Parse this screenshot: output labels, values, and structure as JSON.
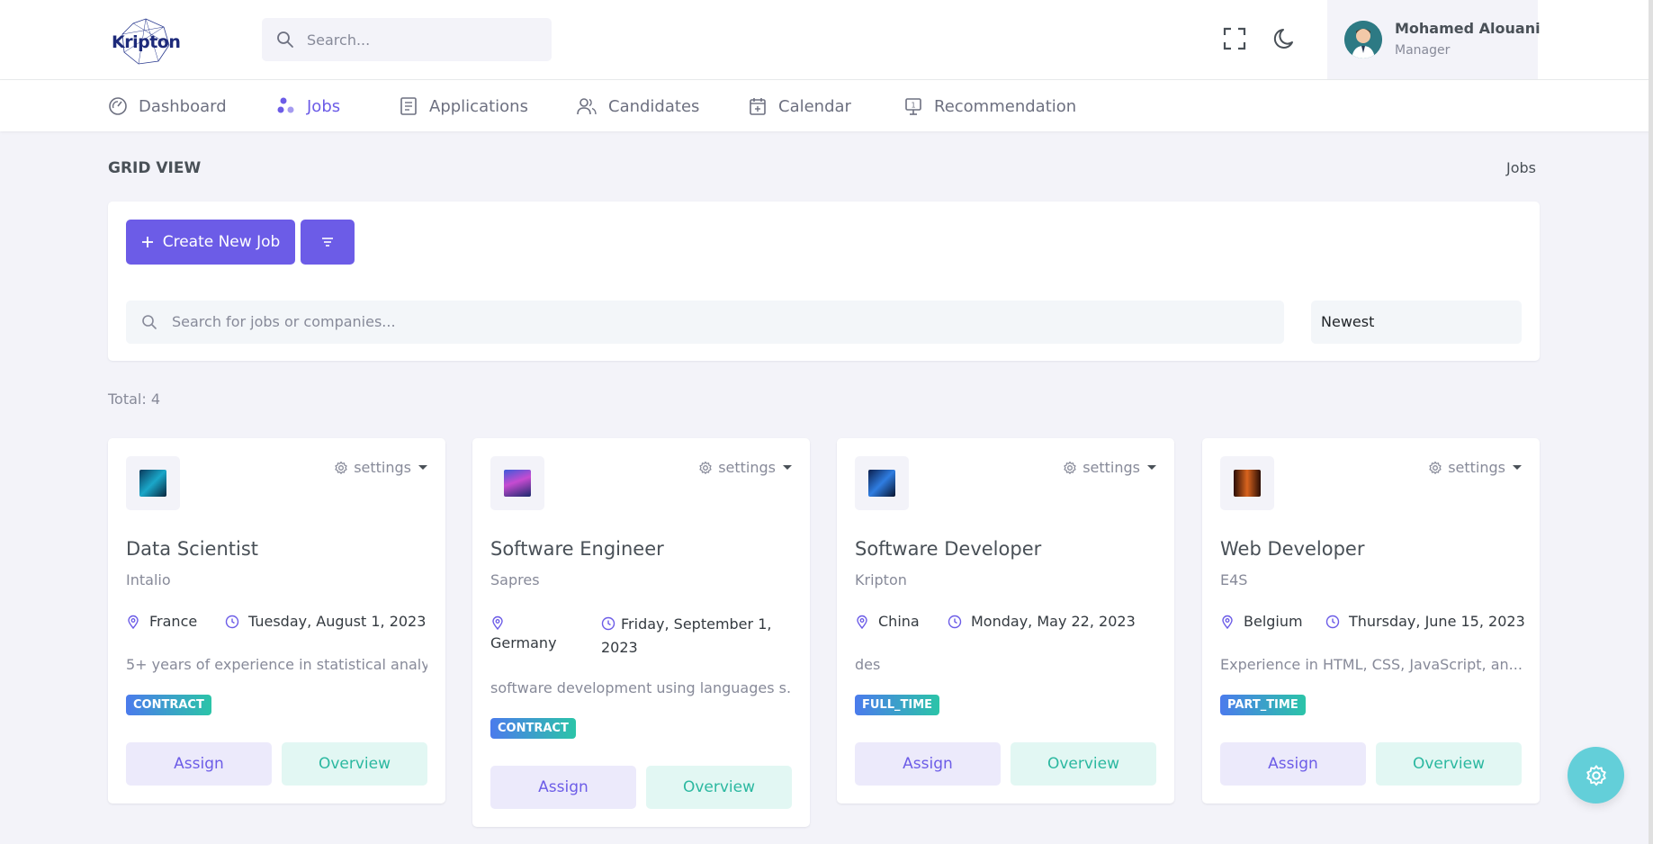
{
  "header": {
    "logo_text": "Kripton",
    "search_placeholder": "Search...",
    "icons": {
      "fullscreen": "fullscreen-icon",
      "theme": "moon-icon"
    },
    "user": {
      "name": "Mohamed Alouani",
      "role": "Manager"
    }
  },
  "nav": {
    "items": [
      {
        "label": "Dashboard",
        "icon": "dashboard-icon",
        "active": false
      },
      {
        "label": "Jobs",
        "icon": "jobs-icon",
        "active": true
      },
      {
        "label": "Applications",
        "icon": "document-icon",
        "active": false
      },
      {
        "label": "Candidates",
        "icon": "users-icon",
        "active": false
      },
      {
        "label": "Calendar",
        "icon": "calendar-icon",
        "active": false
      },
      {
        "label": "Recommendation",
        "icon": "recommendation-icon",
        "active": false
      }
    ]
  },
  "page": {
    "title": "GRID VIEW",
    "breadcrumb": "Jobs"
  },
  "toolbar": {
    "create_label": "Create New Job",
    "search_placeholder": "Search for jobs or companies...",
    "sort_value": "Newest"
  },
  "total_label": "Total: 4",
  "jobs": [
    {
      "title": "Data Scientist",
      "company": "Intalio",
      "location": "France",
      "date": "Tuesday, August 1, 2023",
      "description": "5+ years of experience in statistical analy...",
      "type": "CONTRACT",
      "settings_label": "settings",
      "assign_label": "Assign",
      "overview_label": "Overview"
    },
    {
      "title": "Software Engineer",
      "company": "Sapres",
      "location": "Germany",
      "date_line1": "Friday, September 1,",
      "date_line2": "2023",
      "description": "software development using languages s...",
      "type": "CONTRACT",
      "settings_label": "settings",
      "assign_label": "Assign",
      "overview_label": "Overview"
    },
    {
      "title": "Software Developer",
      "company": "Kripton",
      "location": "China",
      "date": "Monday, May 22, 2023",
      "description": "des",
      "type": "FULL_TIME",
      "settings_label": "settings",
      "assign_label": "Assign",
      "overview_label": "Overview"
    },
    {
      "title": "Web Developer",
      "company": "E4S",
      "location": "Belgium",
      "date": "Thursday, June 15, 2023",
      "description": "Experience in HTML, CSS, JavaScript, an...",
      "type": "PART_TIME",
      "settings_label": "settings",
      "assign_label": "Assign",
      "overview_label": "Overview"
    }
  ],
  "colors": {
    "primary": "#6c5ce7",
    "teal": "#2bb8a0",
    "fab": "#63cfd9"
  }
}
